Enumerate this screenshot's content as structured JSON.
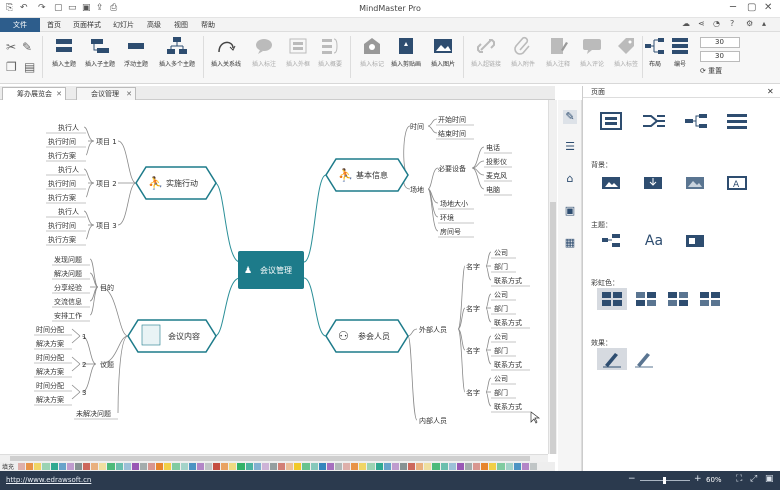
{
  "app": {
    "title": "MindMaster Pro"
  },
  "menu": {
    "file": "文件",
    "items": [
      "首页",
      "页面样式",
      "幻灯片",
      "高级",
      "视图",
      "帮助"
    ]
  },
  "ribbon": {
    "buttons": [
      "插入主题",
      "插入子主题",
      "浮动主题",
      "插入多个主题",
      "插入关系线",
      "插入标注",
      "插入外框",
      "插入概要",
      "插入标记",
      "插入剪贴画",
      "插入图片",
      "插入超链接",
      "插入附件",
      "插入注释",
      "插入评论",
      "插入标签",
      "布局",
      "编号"
    ],
    "spin1": "30",
    "spin2": "30",
    "reset": "重置"
  },
  "tabs": [
    {
      "label": "筹办展览会"
    },
    {
      "label": "会议管理"
    }
  ],
  "mindmap": {
    "root": "会议管理",
    "left_topics": [
      "实施行动",
      "会议内容"
    ],
    "right_topics": [
      "基本信息",
      "参会人员"
    ],
    "actions": {
      "labels": [
        "项目 1",
        "项目 2",
        "项目 3"
      ],
      "items": [
        "执行人",
        "执行时间",
        "执行方案"
      ]
    },
    "content": {
      "goal_label": "目的",
      "goal_items": [
        "发现问题",
        "解决问题",
        "分享经验",
        "交流信息",
        "安排工作"
      ],
      "agenda_label": "议题",
      "agenda_nums": [
        "1",
        "2",
        "3"
      ],
      "agenda_items": [
        "时间分配",
        "解决方案"
      ],
      "unsolved": "未解决问题"
    },
    "info": {
      "time": "时间",
      "time_items": [
        "开始时间",
        "结束时间"
      ],
      "venue": "场地",
      "equip": "必要设备",
      "equip_items": [
        "电话",
        "投影仪",
        "麦克风",
        "电脑"
      ],
      "venue_items": [
        "场地大小",
        "环境",
        "房间号"
      ]
    },
    "people": {
      "external": "外部人员",
      "internal": "内部人员",
      "name": "名字",
      "fields": [
        "公司",
        "部门",
        "联系方式"
      ]
    }
  },
  "panel": {
    "title": "页面",
    "background": "背景：",
    "theme": "主题：",
    "rainbow": "彩虹色：",
    "effect": "效果：",
    "font_sample": "Aa"
  },
  "palette": {
    "label": "填充"
  },
  "status": {
    "url": "http://www.edrawsoft.cn",
    "zoom": "60%"
  },
  "colors": {
    "accent": "#1d7b8a",
    "menu": "#2d5d8c",
    "status": "#2b3a4e"
  }
}
